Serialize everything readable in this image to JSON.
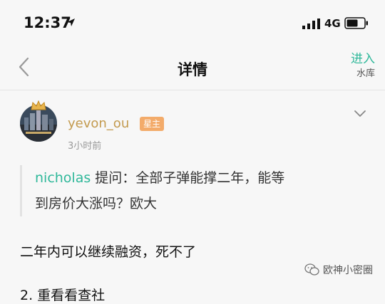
{
  "status_bar": {
    "time": "12:37",
    "network": "4G"
  },
  "nav": {
    "title": "详情",
    "enter_label": "进入",
    "enter_sub": "水库"
  },
  "post": {
    "username": "yevon_ou",
    "badge": "星主",
    "time": "3小时前",
    "question": {
      "author": "nicholas",
      "line1_text": " 提问：全部子弹能撑二年，能等",
      "line2_text": "到房价大涨吗？欧大"
    },
    "answer": "二年内可以继续融资，死不了",
    "bottom_partial": "2. 重看看查社"
  },
  "watermark": {
    "text": "欧神小密圈"
  },
  "colors": {
    "accent": "#2fb89a",
    "username": "#c39a4e",
    "badge_bg": "#f3ab6a"
  }
}
